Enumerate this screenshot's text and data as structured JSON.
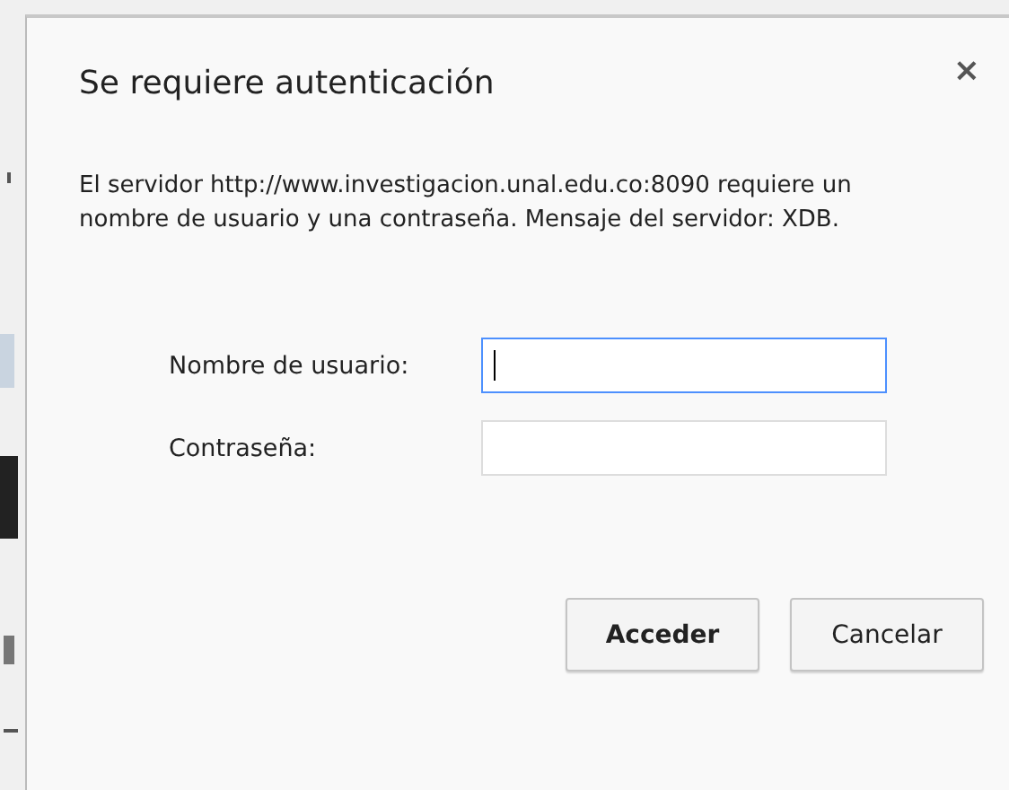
{
  "dialog": {
    "title": "Se requiere autenticación",
    "close": "×",
    "message": "El servidor http://www.investigacion.unal.edu.co:8090 requiere un nombre de usuario y una contraseña. Mensaje del servidor: XDB.",
    "fields": [
      {
        "label": "Nombre de usuario:",
        "focused": true
      },
      {
        "label": "Contraseña:",
        "focused": false
      }
    ],
    "buttons": [
      {
        "label": "Acceder",
        "default": true
      },
      {
        "label": "Cancelar",
        "default": false
      }
    ]
  }
}
